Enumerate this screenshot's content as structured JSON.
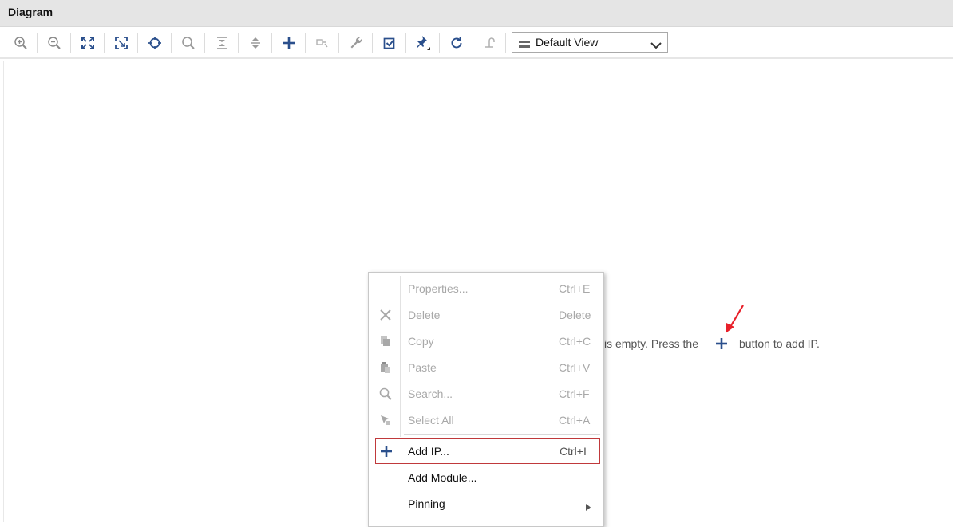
{
  "window": {
    "title": "Diagram"
  },
  "toolbar": {
    "view_select": {
      "value": "Default View"
    }
  },
  "canvas": {
    "hint_text_prefix": "is empty. Press the",
    "hint_text_suffix": "button to add IP."
  },
  "context_menu": {
    "items": [
      {
        "label": "Properties...",
        "shortcut": "Ctrl+E",
        "enabled": false
      },
      {
        "label": "Delete",
        "shortcut": "Delete",
        "enabled": false
      },
      {
        "label": "Copy",
        "shortcut": "Ctrl+C",
        "enabled": false
      },
      {
        "label": "Paste",
        "shortcut": "Ctrl+V",
        "enabled": false
      },
      {
        "label": "Search...",
        "shortcut": "Ctrl+F",
        "enabled": false
      },
      {
        "label": "Select All",
        "shortcut": "Ctrl+A",
        "enabled": false
      },
      {
        "label": "Add IP...",
        "shortcut": "Ctrl+I",
        "enabled": true,
        "highlighted": true
      },
      {
        "label": "Add Module...",
        "shortcut": "",
        "enabled": true
      },
      {
        "label": "Pinning",
        "shortcut": "",
        "enabled": true,
        "has_submenu": true
      }
    ]
  },
  "colors": {
    "accent_blue": "#2a4f8c",
    "highlight_border": "#c0393b",
    "annotation_arrow": "#e8202a"
  }
}
